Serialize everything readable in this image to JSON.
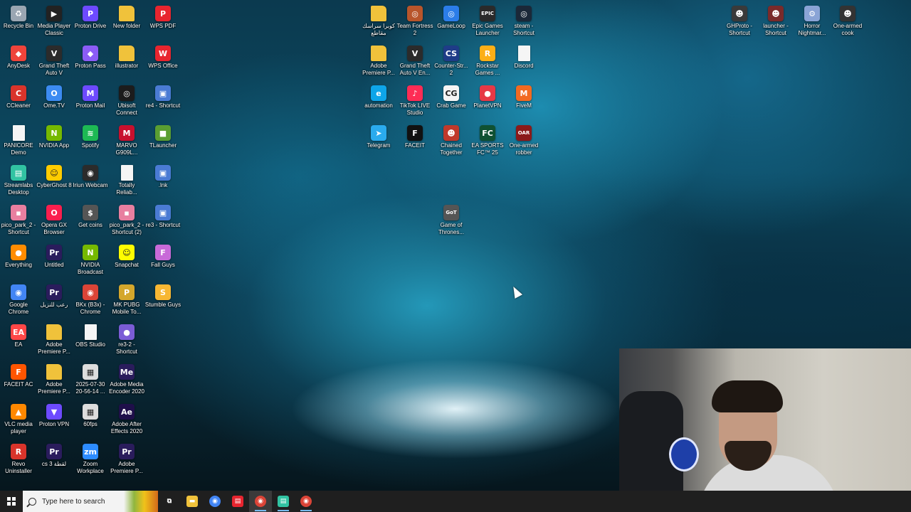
{
  "desktop": {
    "icons": [
      {
        "label": "Recycle Bin",
        "icon": "recycle-bin-icon",
        "color": "#9aa6b2",
        "glyph": "♻"
      },
      {
        "label": "Media Player Classic",
        "icon": "media-player-icon",
        "color": "#222222",
        "glyph": "▶"
      },
      {
        "label": "Proton Drive",
        "icon": "proton-drive-icon",
        "color": "#6d4aff",
        "glyph": "P"
      },
      {
        "label": "New folder",
        "icon": "folder-icon",
        "color": "#f0c23b",
        "glyph": ""
      },
      {
        "label": "WPS PDF",
        "icon": "wps-pdf-icon",
        "color": "#e8252f",
        "glyph": "P"
      },
      {
        "label": "AnyDesk",
        "icon": "anydesk-icon",
        "color": "#ef443b",
        "glyph": "◆"
      },
      {
        "label": "Grand Theft Auto V",
        "icon": "gta-v-icon",
        "color": "#2b2b2b",
        "glyph": "V"
      },
      {
        "label": "Proton Pass",
        "icon": "proton-pass-icon",
        "color": "#8b5cf6",
        "glyph": "◆"
      },
      {
        "label": "illustrator",
        "icon": "folder-icon",
        "color": "#f0c23b",
        "glyph": ""
      },
      {
        "label": "WPS Office",
        "icon": "wps-office-icon",
        "color": "#e8252f",
        "glyph": "W"
      },
      {
        "label": "CCleaner",
        "icon": "ccleaner-icon",
        "color": "#d9342b",
        "glyph": "C"
      },
      {
        "label": "Ome.TV",
        "icon": "ome-tv-icon",
        "color": "#3c8bf2",
        "glyph": "O"
      },
      {
        "label": "Proton Mail",
        "icon": "proton-mail-icon",
        "color": "#6d4aff",
        "glyph": "M"
      },
      {
        "label": "Ubisoft Connect",
        "icon": "ubisoft-icon",
        "color": "#1c1c1c",
        "glyph": "◎"
      },
      {
        "label": "re4 - Shortcut",
        "icon": "shortcut-icon",
        "color": "#4a7bd4",
        "glyph": "▣"
      },
      {
        "label": "PANICORE Demo",
        "icon": "file-icon",
        "color": "#f5f5f5",
        "glyph": ""
      },
      {
        "label": "NVIDIA App",
        "icon": "nvidia-icon",
        "color": "#76b900",
        "glyph": "N"
      },
      {
        "label": "Spotify",
        "icon": "spotify-icon",
        "color": "#1db954",
        "glyph": "≋"
      },
      {
        "label": "MARVO G909L...",
        "icon": "marvo-icon",
        "color": "#c8102e",
        "glyph": "M"
      },
      {
        "label": "TLauncher",
        "icon": "tlauncher-icon",
        "color": "#5a9e32",
        "glyph": "■"
      },
      {
        "label": "Streamlabs Desktop",
        "icon": "streamlabs-icon",
        "color": "#31c3a2",
        "glyph": "▤"
      },
      {
        "label": "CyberGhost 8",
        "icon": "cyberghost-icon",
        "color": "#ffcc00",
        "glyph": "☺"
      },
      {
        "label": "Iriun Webcam",
        "icon": "iriun-icon",
        "color": "#2b2b2b",
        "glyph": "◉"
      },
      {
        "label": "Totally Reliab...",
        "icon": "file-icon",
        "color": "#f5f5f5",
        "glyph": ""
      },
      {
        "label": ".lnk",
        "icon": "shortcut-icon",
        "color": "#4a7bd4",
        "glyph": "▣"
      },
      {
        "label": "pico_park_2 - Shortcut",
        "icon": "pico-park-icon",
        "color": "#e87fa0",
        "glyph": "▪"
      },
      {
        "label": "Opera GX Browser",
        "icon": "opera-gx-icon",
        "color": "#fa1e4e",
        "glyph": "O"
      },
      {
        "label": "Get coins",
        "icon": "coins-icon",
        "color": "#555555",
        "glyph": "$"
      },
      {
        "label": "pico_park_2 - Shortcut (2)",
        "icon": "pico-park-icon",
        "color": "#e87fa0",
        "glyph": "▪"
      },
      {
        "label": "re3 - Shortcut",
        "icon": "shortcut-icon",
        "color": "#4a7bd4",
        "glyph": "▣"
      },
      {
        "label": "Everything",
        "icon": "everything-icon",
        "color": "#ff8c00",
        "glyph": "●"
      },
      {
        "label": "Untitled",
        "icon": "premiere-file-icon",
        "color": "#2a1c5c",
        "glyph": "Pr"
      },
      {
        "label": "NVIDIA Broadcast",
        "icon": "nvidia-broadcast-icon",
        "color": "#76b900",
        "glyph": "N"
      },
      {
        "label": "Snapchat",
        "icon": "snapchat-icon",
        "color": "#fffc00",
        "glyph": "☺"
      },
      {
        "label": "Fall Guys",
        "icon": "fall-guys-icon",
        "color": "#c86ad8",
        "glyph": "F"
      },
      {
        "label": "Google Chrome",
        "icon": "chrome-icon",
        "color": "#4285f4",
        "glyph": "◉"
      },
      {
        "label": "رعب للنزيل",
        "icon": "premiere-file-icon",
        "color": "#2a1c5c",
        "glyph": "Pr"
      },
      {
        "label": "BKx (B3x) - Chrome",
        "icon": "chrome-icon",
        "color": "#db4437",
        "glyph": "◉"
      },
      {
        "label": "MK PUBG Mobile To...",
        "icon": "pubg-icon",
        "color": "#d4a72c",
        "glyph": "P"
      },
      {
        "label": "Stumble Guys",
        "icon": "stumble-guys-icon",
        "color": "#f7b733",
        "glyph": "S"
      },
      {
        "label": "EA",
        "icon": "ea-icon",
        "color": "#ff4747",
        "glyph": "EA"
      },
      {
        "label": "Adobe Premiere P...",
        "icon": "folder-icon",
        "color": "#f0c23b",
        "glyph": ""
      },
      {
        "label": "OBS Studio",
        "icon": "file-icon",
        "color": "#f5f5f5",
        "glyph": ""
      },
      {
        "label": "re3-2 - Shortcut",
        "icon": "shortcut-icon",
        "color": "#7b5cd6",
        "glyph": "●"
      },
      {
        "label": "FACEIT AC",
        "icon": "faceit-ac-icon",
        "color": "#ff5500",
        "glyph": "F"
      },
      {
        "label": "Adobe Premiere P...",
        "icon": "folder-icon",
        "color": "#f0c23b",
        "glyph": ""
      },
      {
        "label": "2025-07-30 20-56-14 ...",
        "icon": "video-file-icon",
        "color": "#dddddd",
        "glyph": "▦"
      },
      {
        "label": "Adobe Media Encoder 2020",
        "icon": "media-encoder-icon",
        "color": "#2a1c5c",
        "glyph": "Me"
      },
      {
        "label": "VLC media player",
        "icon": "vlc-icon",
        "color": "#ff8800",
        "glyph": "▲"
      },
      {
        "label": "Proton VPN",
        "icon": "proton-vpn-icon",
        "color": "#6d4aff",
        "glyph": "▼"
      },
      {
        "label": "60fps",
        "icon": "video-file-icon",
        "color": "#dddddd",
        "glyph": "▦"
      },
      {
        "label": "Adobe After Effects 2020",
        "icon": "after-effects-icon",
        "color": "#1f0f4a",
        "glyph": "Ae"
      },
      {
        "label": "Revo Uninstaller",
        "icon": "revo-icon",
        "color": "#d9342b",
        "glyph": "R"
      },
      {
        "label": "cs 3 لقطة",
        "icon": "premiere-file-icon",
        "color": "#2a1c5c",
        "glyph": "Pr"
      },
      {
        "label": "Zoom Workplace",
        "icon": "zoom-icon",
        "color": "#2d8cff",
        "glyph": "zm"
      },
      {
        "label": "Adobe Premiere P...",
        "icon": "premiere-icon",
        "color": "#2a1c5c",
        "glyph": "Pr"
      },
      {
        "label": "كوبرا سراسك مقاطع",
        "icon": "folder-icon",
        "color": "#f0c23b",
        "glyph": ""
      },
      {
        "label": "Team Fortress 2",
        "icon": "tf2-icon",
        "color": "#b8552b",
        "glyph": "◎"
      },
      {
        "label": "GameLoop",
        "icon": "gameloop-icon",
        "color": "#2b7de9",
        "glyph": "◎"
      },
      {
        "label": "Epic Games Launcher",
        "icon": "epic-games-icon",
        "color": "#2a2a2a",
        "glyph": "EPIC"
      },
      {
        "label": "steam - Shortcut",
        "icon": "steam-icon",
        "color": "#1b2838",
        "glyph": "◎"
      },
      {
        "label": "Adobe Premiere P...",
        "icon": "folder-icon",
        "color": "#f0c23b",
        "glyph": ""
      },
      {
        "label": "Grand Theft Auto V En...",
        "icon": "gta-v-icon",
        "color": "#2b2b2b",
        "glyph": "V"
      },
      {
        "label": "Counter-Str... 2",
        "icon": "cs2-icon",
        "color": "#1f3c88",
        "glyph": "CS"
      },
      {
        "label": "Rockstar Games ...",
        "icon": "rockstar-icon",
        "color": "#fcaf17",
        "glyph": "R"
      },
      {
        "label": "Discord",
        "icon": "file-icon",
        "color": "#f5f5f5",
        "glyph": ""
      },
      {
        "label": "automation",
        "icon": "edge-icon",
        "color": "#0ea5e9",
        "glyph": "e"
      },
      {
        "label": "TikTok LIVE Studio",
        "icon": "tiktok-live-icon",
        "color": "#fe2c55",
        "glyph": "♪"
      },
      {
        "label": "Crab Game",
        "icon": "crab-game-icon",
        "color": "#f5f5f5",
        "glyph": "CG"
      },
      {
        "label": "PlanetVPN",
        "icon": "planetvpn-icon",
        "color": "#e63946",
        "glyph": "●"
      },
      {
        "label": "FiveM",
        "icon": "fivem-icon",
        "color": "#f26a21",
        "glyph": "M"
      },
      {
        "label": "Telegram",
        "icon": "telegram-icon",
        "color": "#2aabee",
        "glyph": "➤"
      },
      {
        "label": "FACEIT",
        "icon": "faceit-icon",
        "color": "#111111",
        "glyph": "F"
      },
      {
        "label": "Chained Together",
        "icon": "chained-together-icon",
        "color": "#c0392b",
        "glyph": "☻"
      },
      {
        "label": "EA SPORTS FC™ 25",
        "icon": "ea-fc-icon",
        "color": "#0f5132",
        "glyph": "FC"
      },
      {
        "label": "One-armed robber",
        "icon": "one-armed-robber-icon",
        "color": "#8b1a1a",
        "glyph": "OAR"
      },
      {
        "label": "Game of Thrones...",
        "icon": "game-of-thrones-icon",
        "color": "#555555",
        "glyph": "GoT"
      },
      {
        "label": "GHProto - Shortcut",
        "icon": "ghproto-icon",
        "color": "#3a3a3a",
        "glyph": "☻"
      },
      {
        "label": "launcher - Shortcut",
        "icon": "launcher-icon",
        "color": "#7a2a2a",
        "glyph": "☻"
      },
      {
        "label": "Horror Nightmar...",
        "icon": "horror-nightmare-icon",
        "color": "#8aa4d6",
        "glyph": "⚙"
      },
      {
        "label": "One-armed cook",
        "icon": "one-armed-cook-icon",
        "color": "#333333",
        "glyph": "☻"
      }
    ]
  },
  "taskbar": {
    "search_placeholder": "Type here to search",
    "items": [
      {
        "icon": "task-view-icon",
        "glyph": "⧉",
        "color": "#1f1f1f",
        "state": "none"
      },
      {
        "icon": "file-explorer-icon",
        "glyph": "▬",
        "color": "#f0c23b",
        "state": "none"
      },
      {
        "icon": "chrome-icon",
        "glyph": "◉",
        "color": "#4285f4",
        "state": "none"
      },
      {
        "icon": "document-app-icon",
        "glyph": "▤",
        "color": "#e8252f",
        "state": "none"
      },
      {
        "icon": "chrome-profile-icon",
        "glyph": "◉",
        "color": "#db4437",
        "state": "open"
      },
      {
        "icon": "streamlabs-icon",
        "glyph": "▤",
        "color": "#31c3a2",
        "state": "active"
      },
      {
        "icon": "chrome-active-icon",
        "glyph": "◉",
        "color": "#db4437",
        "state": "active"
      }
    ]
  }
}
